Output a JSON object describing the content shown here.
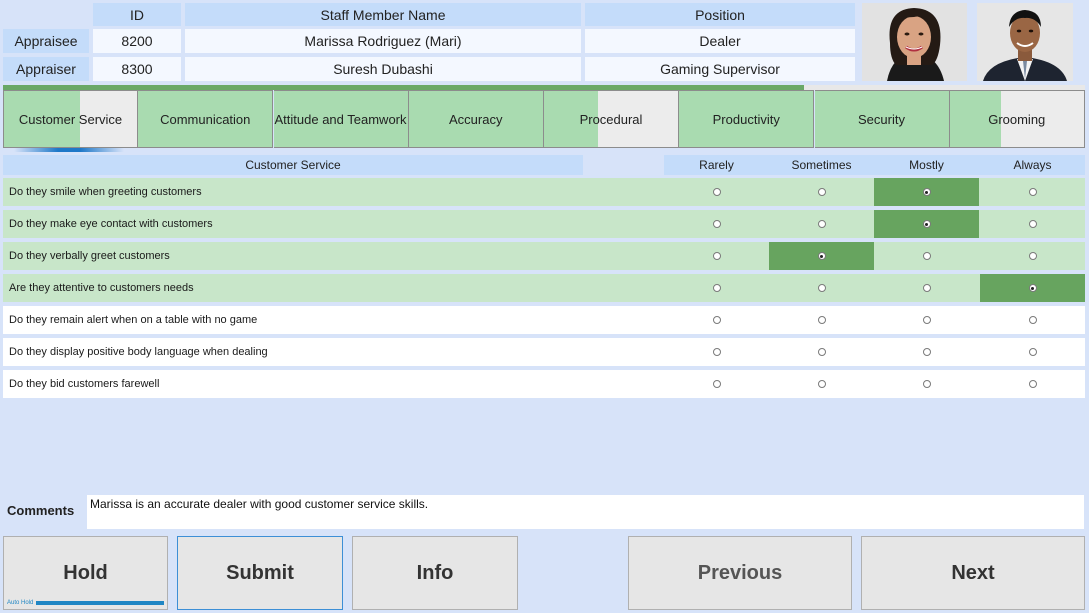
{
  "header": {
    "col_id": "ID",
    "col_name": "Staff Member Name",
    "col_position": "Position",
    "appraisee": {
      "label": "Appraisee",
      "id": "8200",
      "name": "Marissa Rodriguez (Mari)",
      "position": "Dealer"
    },
    "appraiser": {
      "label": "Appraiser",
      "id": "8300",
      "name": "Suresh Dubashi",
      "position": "Gaming Supervisor"
    }
  },
  "tabs": [
    {
      "label": "Customer Service",
      "progress": 0.57,
      "active": true
    },
    {
      "label": "Communication",
      "progress": 1.0
    },
    {
      "label": "Attitude and Teamwork",
      "progress": 1.0
    },
    {
      "label": "Accuracy",
      "progress": 1.0
    },
    {
      "label": "Procedural",
      "progress": 0.4
    },
    {
      "label": "Productivity",
      "progress": 1.0
    },
    {
      "label": "Security",
      "progress": 1.0
    },
    {
      "label": "Grooming",
      "progress": 0.38
    }
  ],
  "overall_progress": 0.74,
  "grid": {
    "section_title": "Customer Service",
    "options": [
      "Rarely",
      "Sometimes",
      "Mostly",
      "Always"
    ],
    "questions": [
      {
        "text": "Do they smile when greeting customers",
        "selected": 2
      },
      {
        "text": "Do they make eye contact with customers",
        "selected": 2
      },
      {
        "text": "Do they verbally greet customers",
        "selected": 1
      },
      {
        "text": "Are they attentive to customers needs",
        "selected": 3
      },
      {
        "text": "Do they remain alert when on a table with no game",
        "selected": -1
      },
      {
        "text": "Do they display positive body language when dealing",
        "selected": -1
      },
      {
        "text": "Do they bid customers farewell",
        "selected": -1
      }
    ]
  },
  "comments": {
    "label": "Comments",
    "value": "Marissa is an accurate dealer with good customer service skills."
  },
  "buttons": {
    "hold": "Hold",
    "auto_hold": "Auto Hold",
    "submit": "Submit",
    "info": "Info",
    "previous": "Previous",
    "next": "Next"
  },
  "colors": {
    "selected": "#67a45f",
    "answered_row": "#c8e6c9",
    "tab_done": "#a9dbb0",
    "header": "#c4dcfa",
    "accent": "#1f86c4"
  }
}
